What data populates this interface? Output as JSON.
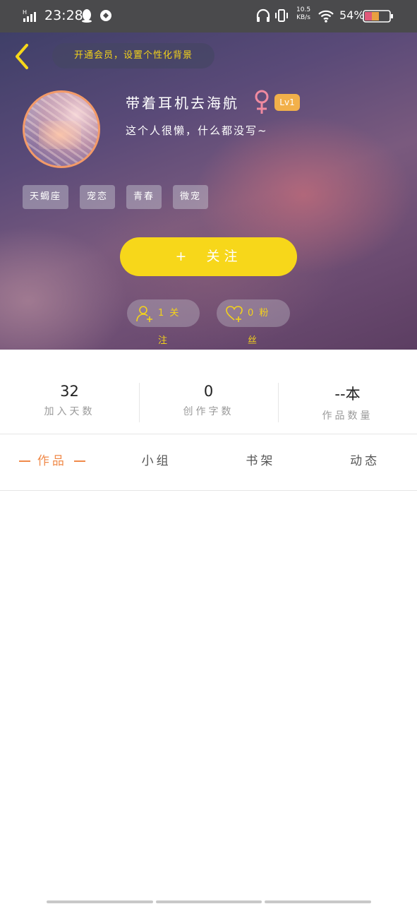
{
  "status_bar": {
    "time": "23:28",
    "network_speed_value": "10.5",
    "network_speed_unit": "KB/s",
    "battery_percent": "54%"
  },
  "header": {
    "vip_prompt": "开通会员，设置个性化背景",
    "username": "带着耳机去海航",
    "level": "Lv1",
    "bio": "这个人很懒，什么都没写~",
    "tags": [
      "天蝎座",
      "宠恋",
      "青春",
      "微宠"
    ],
    "follow_button_icon": "+",
    "follow_button_label": "关注",
    "following_text": "1 关注",
    "fans_text": "0 粉丝"
  },
  "stats": [
    {
      "value": "32",
      "label": "加入天数"
    },
    {
      "value": "0",
      "label": "创作字数"
    },
    {
      "value": "--本",
      "label": "作品数量"
    }
  ],
  "tabs": [
    {
      "label": "作品",
      "active": true
    },
    {
      "label": "小组",
      "active": false
    },
    {
      "label": "书架",
      "active": false
    },
    {
      "label": "动态",
      "active": false
    }
  ],
  "colors": {
    "accent_yellow": "#f7d71a",
    "avatar_ring": "#f39a68",
    "level_badge": "#f2b04a",
    "active_tab": "#f08a4a",
    "gender_icon": "#f08aa0"
  },
  "icons": {
    "back": "chevron-left-icon",
    "gender": "female-icon",
    "following": "person-plus-icon",
    "fans": "heart-plus-icon"
  }
}
